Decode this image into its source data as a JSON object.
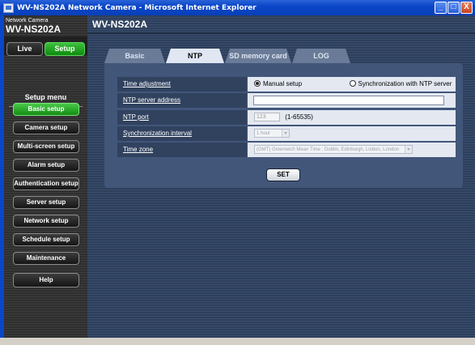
{
  "window": {
    "title": "WV-NS202A Network Camera - Microsoft Internet Explorer",
    "minimize": "_",
    "maximize": "□",
    "close": "X"
  },
  "brand": {
    "line1": "Network Camera",
    "line2": "WV-NS202A"
  },
  "mode": {
    "live": "Live",
    "setup": "Setup"
  },
  "menu": {
    "heading": "Setup menu",
    "items": [
      "Basic setup",
      "Camera setup",
      "Multi-screen setup",
      "Alarm setup",
      "Authentication setup",
      "Server setup",
      "Network setup",
      "Schedule setup",
      "Maintenance",
      "Help"
    ]
  },
  "page": {
    "title": "WV-NS202A"
  },
  "tabs": [
    "Basic",
    "NTP",
    "SD memory card",
    "LOG"
  ],
  "form": {
    "time_adjustment": {
      "label": "Time adjustment",
      "option1": "Manual setup",
      "option2": "Synchronization with NTP server"
    },
    "ntp_server": {
      "label": "NTP server address",
      "value": ""
    },
    "ntp_port": {
      "label": "NTP port",
      "value": "123",
      "range": "(1-65535)"
    },
    "sync_interval": {
      "label": "Synchronization interval",
      "value": "1 hour"
    },
    "time_zone": {
      "label": "Time zone",
      "value": "(GMT) Greenwich Mean Time : Dublin, Edinburgh, Lisbon, London"
    },
    "set_label": "SET"
  }
}
